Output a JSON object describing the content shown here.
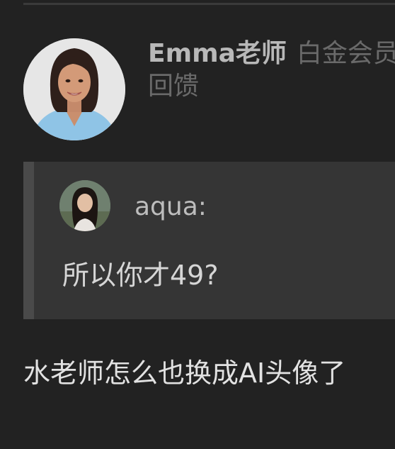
{
  "post": {
    "author": {
      "name": "Emma老师",
      "badge": "白金会员",
      "avatar_icon": "profile-photo"
    },
    "feedback_label": "回馈",
    "quote": {
      "author": "aqua:",
      "text": "所以你才49?",
      "avatar_icon": "profile-photo"
    },
    "reply_text": "水老师怎么也换成AI头像了"
  },
  "colors": {
    "background": "#222222",
    "quote_background": "#353535",
    "quote_bar": "#4a4a4a",
    "username": "#b8b8b8",
    "muted_text": "#6a6a6a",
    "body_text": "#e2e2e2"
  }
}
